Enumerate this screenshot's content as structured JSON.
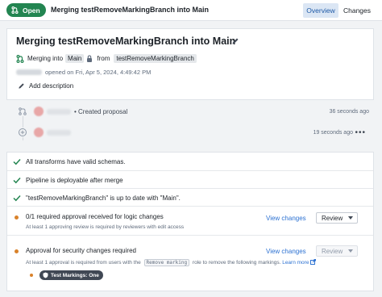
{
  "topbar": {
    "status": "Open",
    "title": "Merging testRemoveMarkingBranch into Main",
    "tabs": [
      "Overview",
      "Changes"
    ]
  },
  "header": {
    "title": "Merging testRemoveMarkingBranch into Main",
    "merging_into_label": "Merging into",
    "target_branch": "Main",
    "from_label": "from",
    "source_branch": "testRemoveMarkingBranch",
    "opened_on": "opened on Fri, Apr 5, 2024, 4:49:42 PM",
    "add_description": "Add description"
  },
  "timeline": {
    "events": [
      {
        "text": "Created proposal",
        "time": "36 seconds ago"
      },
      {
        "text": "",
        "time": "19 seconds ago"
      }
    ]
  },
  "checks": {
    "passed": [
      "All transforms have valid schemas.",
      "Pipeline is deployable after merge",
      "\"testRemoveMarkingBranch\" is up to date with \"Main\"."
    ],
    "approval": {
      "title": "0/1 required approval received for logic changes",
      "sub": "At least 1 approving review is required by reviewers with edit access",
      "view_label": "View changes",
      "review_label": "Review"
    },
    "security": {
      "title": "Approval for security changes required",
      "sub_before": "At least 1 approval is required from users with the",
      "role": "Remove marking",
      "sub_after": "role to remove the following markings.",
      "learn_more": "Learn more",
      "view_label": "View changes",
      "review_label": "Review",
      "marking": "Test Markings: One"
    }
  },
  "colors": {
    "open_badge": "#238551",
    "check_green": "#238551",
    "warning_orange": "#d9822b",
    "link_blue": "#2d72d2"
  }
}
